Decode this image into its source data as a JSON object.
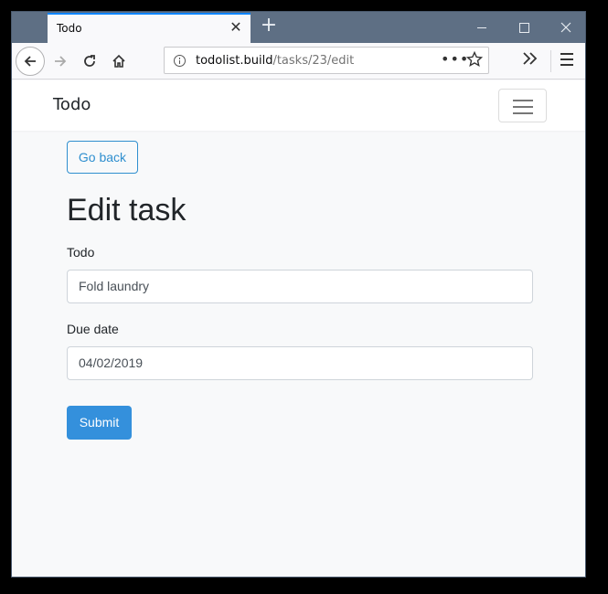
{
  "browser": {
    "tab_title": "Todo",
    "tab_close_symbol": "✕",
    "new_tab_symbol": "+",
    "url_domain": "todolist.build",
    "url_path": "/tasks/23/edit",
    "url_more": "•••",
    "accent_color": "#0a84ff",
    "icons": [
      "back-arrow-icon",
      "forward-arrow-icon",
      "reload-icon",
      "home-icon",
      "info-icon",
      "more-icon",
      "bookmark-star-icon",
      "overflow-icon",
      "hamburger-menu-icon",
      "minimize-icon",
      "maximize-icon",
      "close-icon"
    ]
  },
  "site": {
    "brand": "Todo",
    "go_back_label": "Go back",
    "heading": "Edit task",
    "todo_label": "Todo",
    "todo_value": "Fold laundry",
    "due_label": "Due date",
    "due_value": "04/02/2019",
    "submit_label": "Submit",
    "primary_color": "#3490dc"
  }
}
